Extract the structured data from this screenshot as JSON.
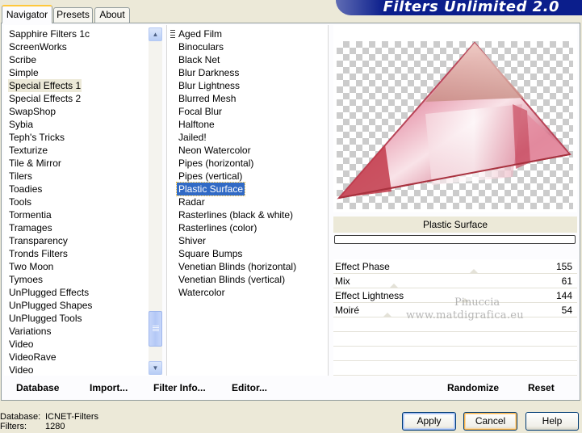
{
  "tabs": [
    {
      "label": "Navigator",
      "active": true
    },
    {
      "label": "Presets",
      "active": false
    },
    {
      "label": "About",
      "active": false
    }
  ],
  "banner": {
    "title": "Filters Unlimited 2.0"
  },
  "categories": [
    "Sapphire Filters 1c",
    "ScreenWorks",
    "Scribe",
    "Simple",
    "Special Effects 1",
    "Special Effects 2",
    "SwapShop",
    "Sybia",
    "Teph's Tricks",
    "Texturize",
    "Tile & Mirror",
    "Tilers",
    "Toadies",
    "Tools",
    "Tormentia",
    "Tramages",
    "Transparency",
    "Tronds Filters",
    "Two Moon",
    "Tymoes",
    "UnPlugged Effects",
    "UnPlugged Shapes",
    "UnPlugged Tools",
    "Variations",
    "Video",
    "VideoRave",
    "Video"
  ],
  "highlighted_category": "Special Effects 1",
  "filters": [
    "Aged Film",
    "Binoculars",
    "Black Net",
    "Blur Darkness",
    "Blur Lightness",
    "Blurred Mesh",
    "Focal Blur",
    "Halftone",
    "Jailed!",
    "Neon Watercolor",
    "Pipes (horizontal)",
    "Pipes (vertical)",
    "Plastic Surface",
    "Radar",
    "Rasterlines (black & white)",
    "Rasterlines (color)",
    "Shiver",
    "Square Bumps",
    "Venetian Blinds (horizontal)",
    "Venetian Blinds (vertical)",
    "Watercolor"
  ],
  "selected_filter": "Plastic Surface",
  "preview": {
    "filter_name": "Plastic Surface"
  },
  "params": [
    {
      "label": "Effect Phase",
      "value": "155",
      "level": 0.608
    },
    {
      "label": "Mix",
      "value": "61",
      "level": 0.239
    },
    {
      "label": "Effect Lightness",
      "value": "144",
      "level": 0.565
    },
    {
      "label": "Moiré",
      "value": "54",
      "level": 0.212
    }
  ],
  "watermark": {
    "line1": "Pinuccia",
    "line2": "www.matdigrafica.eu"
  },
  "bottom_links": {
    "database": "Database",
    "import": "Import...",
    "filter_info": "Filter Info...",
    "editor": "Editor...",
    "randomize": "Randomize",
    "reset": "Reset"
  },
  "info": {
    "database_label": "Database:",
    "database_value": "ICNET-Filters",
    "filters_label": "Filters:",
    "filters_value": "1280"
  },
  "buttons": {
    "apply": "Apply",
    "cancel": "Cancel",
    "help": "Help"
  },
  "colors": {
    "selection": "#316AC5",
    "banner": "#0B1E8C",
    "accent_focus": "#F8B34A"
  }
}
